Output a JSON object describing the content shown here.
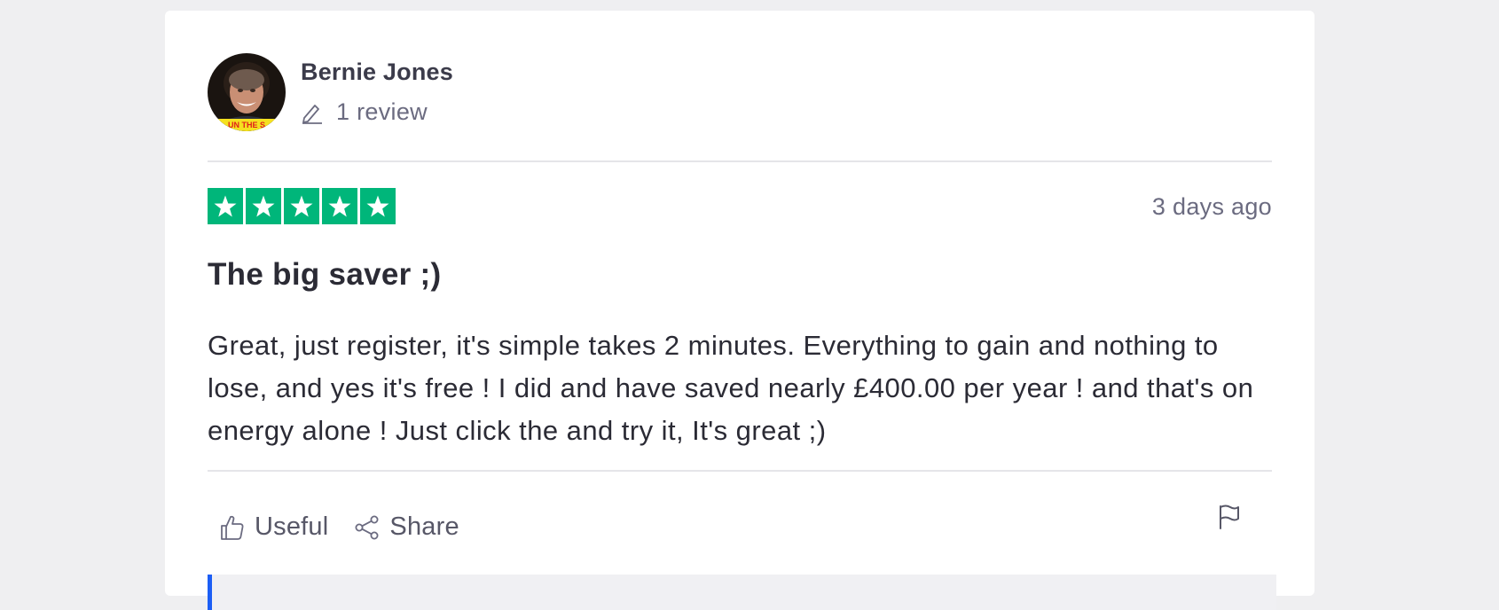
{
  "reviewer": {
    "name": "Bernie Jones",
    "review_count": "1 review",
    "avatar_badge_text": "UN THE S"
  },
  "review": {
    "rating": 5,
    "rating_max": 5,
    "date": "3 days ago",
    "title": "The big saver ;)",
    "body": "Great, just register, it's simple takes 2 minutes. Everything to gain and nothing to lose, and yes it's free ! I did and have saved nearly £400.00 per year ! and that's on energy alone ! Just click the and try it, It's great ;)"
  },
  "actions": {
    "useful_label": "Useful",
    "share_label": "Share"
  },
  "colors": {
    "star_green": "#00b67a",
    "reply_accent": "#1c5ef5",
    "page_bg": "#efeff1"
  },
  "icons": {
    "review_count": "pencil-icon",
    "useful": "thumbs-up-icon",
    "share": "share-icon",
    "report": "flag-icon",
    "rating": "star-icon"
  }
}
